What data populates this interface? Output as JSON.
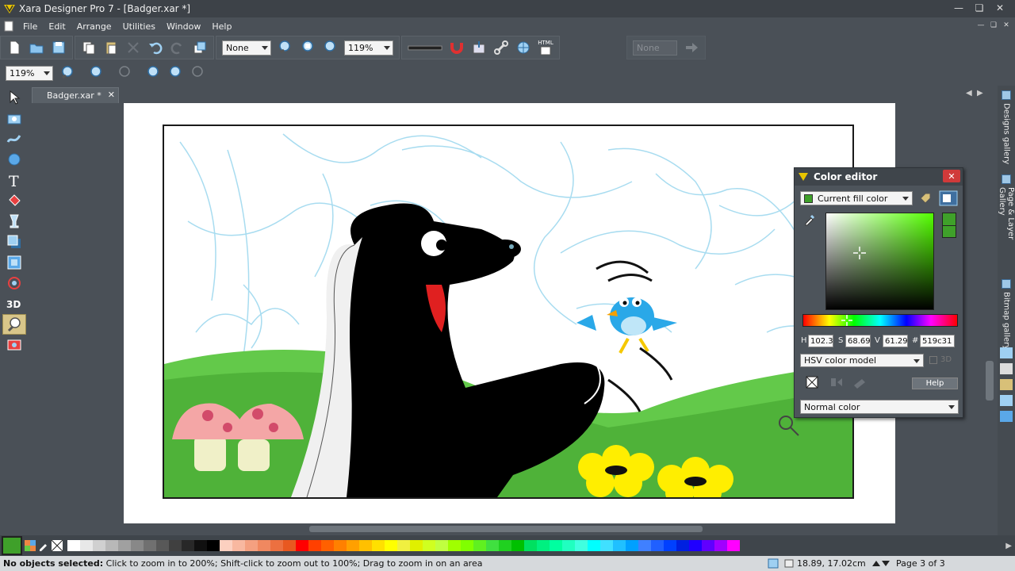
{
  "window": {
    "title": "Xara Designer Pro 7 - [Badger.xar *]"
  },
  "menu": [
    "File",
    "Edit",
    "Arrange",
    "Utilities",
    "Window",
    "Help"
  ],
  "toolbar1": {
    "quality_select": "None",
    "zoom_select": "119%",
    "html_label": "HTML",
    "disabled_select": "None"
  },
  "toolbar2": {
    "zoom_select": "119%"
  },
  "doc_tab": {
    "label": "Badger.xar *",
    "close": "✕"
  },
  "color_editor": {
    "title": "Color editor",
    "close": "✕",
    "fill_select": "Current fill color",
    "fields": [
      {
        "label": "H",
        "value": "102.3"
      },
      {
        "label": "S",
        "value": "68.69"
      },
      {
        "label": "V",
        "value": "61.29"
      },
      {
        "label": "#",
        "value": "519c31"
      }
    ],
    "model_select": "HSV color model",
    "three_d_label": "3D",
    "help_button": "Help",
    "normal_select": "Normal color",
    "current_color": "#3fa02a"
  },
  "galleries": [
    "Designs gallery",
    "Page & Layer Gallery",
    "Bitmap gallery"
  ],
  "palette": {
    "colors": [
      "#ffffff",
      "#e8e8e8",
      "#d0d0d0",
      "#b8b8b8",
      "#a0a0a0",
      "#888888",
      "#707070",
      "#585858",
      "#404040",
      "#282828",
      "#101010",
      "#000000",
      "#fcd0c0",
      "#f8b8a0",
      "#f4a080",
      "#f08860",
      "#ec7040",
      "#e85820",
      "#ff0000",
      "#ff4000",
      "#ff6000",
      "#ff8000",
      "#ffa000",
      "#ffc000",
      "#ffe000",
      "#ffff00",
      "#f0f040",
      "#e0f000",
      "#d0ff20",
      "#c0ff40",
      "#a0ff00",
      "#80ff00",
      "#60f020",
      "#40e040",
      "#20d020",
      "#00c000",
      "#00e060",
      "#00f080",
      "#00ffa0",
      "#20ffc0",
      "#40ffe0",
      "#00ffff",
      "#40e0ff",
      "#20c0ff",
      "#00a0ff",
      "#4080ff",
      "#2060ff",
      "#0040ff",
      "#0020e0",
      "#2000ff",
      "#6000ff",
      "#a000ff",
      "#ff00ff"
    ]
  },
  "status": {
    "message_bold": "No objects selected:",
    "message": " Click to zoom in to 200%; Shift-click to zoom out to 100%; Drag to zoom in on an area",
    "coords": "18.89, 17.02cm",
    "page": "Page 3 of 3"
  }
}
